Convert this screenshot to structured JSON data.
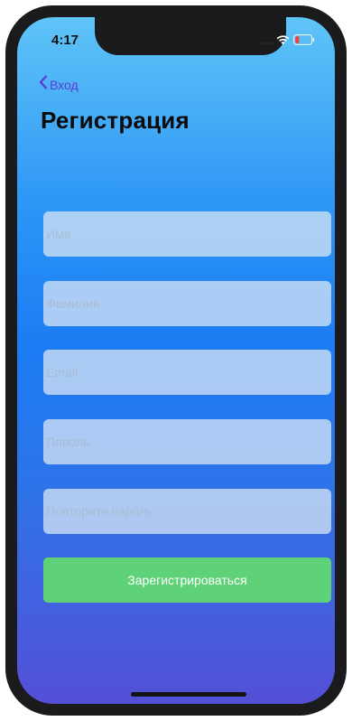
{
  "status_bar": {
    "time": "4:17",
    "icons": [
      "signal-dots-icon",
      "wifi-icon",
      "battery-low-icon"
    ],
    "battery_color": "#ff3b30"
  },
  "nav": {
    "back_label": "Вход",
    "back_icon": "chevron-left-icon"
  },
  "title": "Регистрация",
  "form": {
    "first_name": {
      "placeholder": "Имя",
      "value": ""
    },
    "last_name": {
      "placeholder": "Фамилия",
      "value": ""
    },
    "email": {
      "placeholder": "Email",
      "value": ""
    },
    "password": {
      "placeholder": "Пароль",
      "value": ""
    },
    "password_repeat": {
      "placeholder": "Повторите пароль",
      "value": ""
    },
    "submit_label": "Зарегистрироваться"
  },
  "colors": {
    "accent": "#5b3ad1",
    "submit_button": "#5fd279",
    "gradient_top": "#5fc4f7",
    "gradient_bottom": "#5450d7"
  }
}
